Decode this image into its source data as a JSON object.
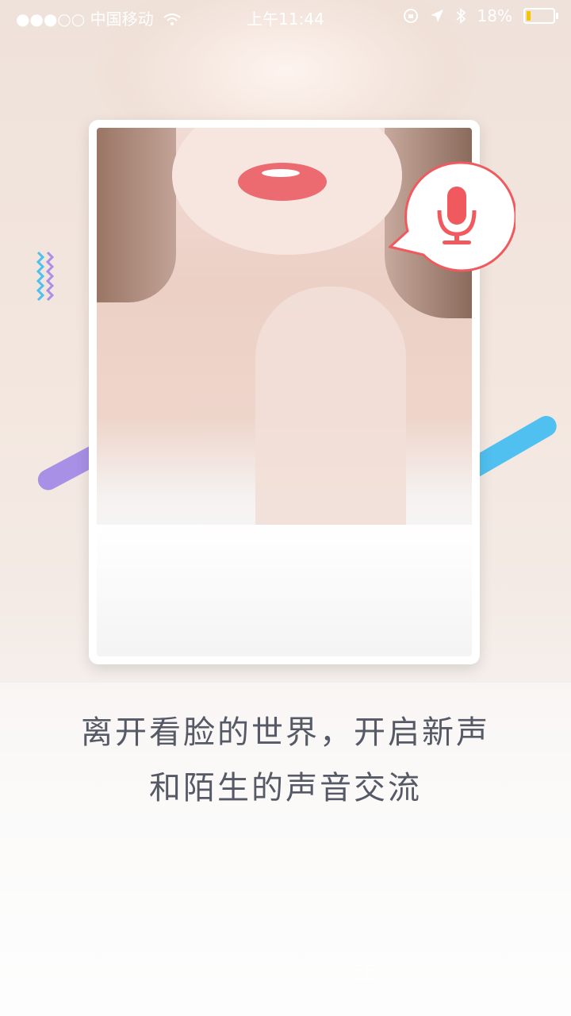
{
  "status_bar": {
    "signal": "●●●○○",
    "carrier": "中国移动",
    "time": "上午11:44",
    "battery_percent": "18%",
    "battery_level": 0.18,
    "battery_color": "#f6c500"
  },
  "icons": {
    "wifi": "wifi-icon",
    "orientation_lock": "orientation-lock-icon",
    "location": "location-arrow-icon",
    "bluetooth": "bluetooth-icon",
    "microphone": "microphone-icon"
  },
  "colors": {
    "mic_accent": "#f05a5f",
    "stripe_purple": "#a890e6",
    "stripe_blue": "#50c0f0",
    "slogan_text": "#555a66"
  },
  "slogan": {
    "line1": "离开看脸的世界，开启新声",
    "line2": "和陌生的声音交流"
  }
}
